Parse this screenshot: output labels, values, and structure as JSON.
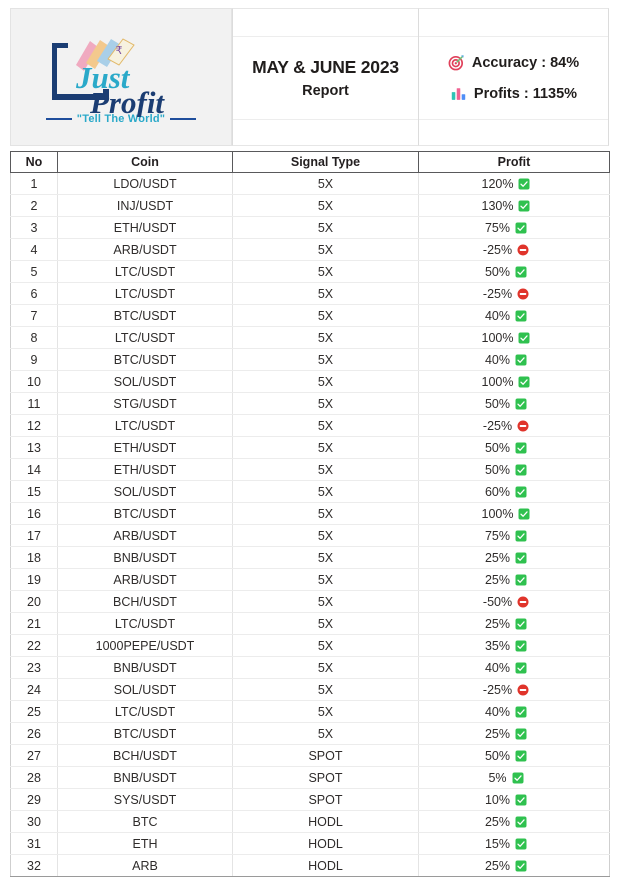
{
  "brand": {
    "name_line1": "Just",
    "name_line2": "Profit",
    "tagline": "\"Tell The World\"",
    "currency_symbol": "₹",
    "colors": {
      "navy": "#1b3d73",
      "cyan": "#2aa9c9",
      "tagline": "#2aa9c9"
    }
  },
  "header": {
    "title": "MAY & JUNE 2023",
    "subtitle": "Report",
    "stats": [
      {
        "icon": "target-icon",
        "label": "Accuracy",
        "value": "84%",
        "text": "Accuracy : 84%"
      },
      {
        "icon": "bar-chart-icon",
        "label": "Profits",
        "value": "1135%",
        "text": "Profits : 1135%"
      }
    ]
  },
  "table": {
    "columns": [
      "No",
      "Coin",
      "Signal Type",
      "Profit"
    ],
    "status_colors": {
      "positive": "#2fc14f",
      "negative": "#e0342b"
    },
    "rows": [
      {
        "no": "1",
        "coin": "LDO/USDT",
        "signal": "5X",
        "profit": "120%",
        "status": "positive"
      },
      {
        "no": "2",
        "coin": "INJ/USDT",
        "signal": "5X",
        "profit": "130%",
        "status": "positive"
      },
      {
        "no": "3",
        "coin": "ETH/USDT",
        "signal": "5X",
        "profit": "75%",
        "status": "positive"
      },
      {
        "no": "4",
        "coin": "ARB/USDT",
        "signal": "5X",
        "profit": "-25%",
        "status": "negative"
      },
      {
        "no": "5",
        "coin": "LTC/USDT",
        "signal": "5X",
        "profit": "50%",
        "status": "positive"
      },
      {
        "no": "6",
        "coin": "LTC/USDT",
        "signal": "5X",
        "profit": "-25%",
        "status": "negative"
      },
      {
        "no": "7",
        "coin": "BTC/USDT",
        "signal": "5X",
        "profit": "40%",
        "status": "positive"
      },
      {
        "no": "8",
        "coin": "LTC/USDT",
        "signal": "5X",
        "profit": "100%",
        "status": "positive"
      },
      {
        "no": "9",
        "coin": "BTC/USDT",
        "signal": "5X",
        "profit": "40%",
        "status": "positive"
      },
      {
        "no": "10",
        "coin": "SOL/USDT",
        "signal": "5X",
        "profit": "100%",
        "status": "positive"
      },
      {
        "no": "11",
        "coin": "STG/USDT",
        "signal": "5X",
        "profit": "50%",
        "status": "positive"
      },
      {
        "no": "12",
        "coin": "LTC/USDT",
        "signal": "5X",
        "profit": "-25%",
        "status": "negative"
      },
      {
        "no": "13",
        "coin": "ETH/USDT",
        "signal": "5X",
        "profit": "50%",
        "status": "positive"
      },
      {
        "no": "14",
        "coin": "ETH/USDT",
        "signal": "5X",
        "profit": "50%",
        "status": "positive"
      },
      {
        "no": "15",
        "coin": "SOL/USDT",
        "signal": "5X",
        "profit": "60%",
        "status": "positive"
      },
      {
        "no": "16",
        "coin": "BTC/USDT",
        "signal": "5X",
        "profit": "100%",
        "status": "positive"
      },
      {
        "no": "17",
        "coin": "ARB/USDT",
        "signal": "5X",
        "profit": "75%",
        "status": "positive"
      },
      {
        "no": "18",
        "coin": "BNB/USDT",
        "signal": "5X",
        "profit": "25%",
        "status": "positive"
      },
      {
        "no": "19",
        "coin": "ARB/USDT",
        "signal": "5X",
        "profit": "25%",
        "status": "positive"
      },
      {
        "no": "20",
        "coin": "BCH/USDT",
        "signal": "5X",
        "profit": "-50%",
        "status": "negative"
      },
      {
        "no": "21",
        "coin": "LTC/USDT",
        "signal": "5X",
        "profit": "25%",
        "status": "positive"
      },
      {
        "no": "22",
        "coin": "1000PEPE/USDT",
        "signal": "5X",
        "profit": "35%",
        "status": "positive"
      },
      {
        "no": "23",
        "coin": "BNB/USDT",
        "signal": "5X",
        "profit": "40%",
        "status": "positive"
      },
      {
        "no": "24",
        "coin": "SOL/USDT",
        "signal": "5X",
        "profit": "-25%",
        "status": "negative"
      },
      {
        "no": "25",
        "coin": "LTC/USDT",
        "signal": "5X",
        "profit": "40%",
        "status": "positive"
      },
      {
        "no": "26",
        "coin": "BTC/USDT",
        "signal": "5X",
        "profit": "25%",
        "status": "positive"
      },
      {
        "no": "27",
        "coin": "BCH/USDT",
        "signal": "SPOT",
        "profit": "50%",
        "status": "positive"
      },
      {
        "no": "28",
        "coin": "BNB/USDT",
        "signal": "SPOT",
        "profit": "5%",
        "status": "positive"
      },
      {
        "no": "29",
        "coin": "SYS/USDT",
        "signal": "SPOT",
        "profit": "10%",
        "status": "positive"
      },
      {
        "no": "30",
        "coin": "BTC",
        "signal": "HODL",
        "profit": "25%",
        "status": "positive"
      },
      {
        "no": "31",
        "coin": "ETH",
        "signal": "HODL",
        "profit": "15%",
        "status": "positive"
      },
      {
        "no": "32",
        "coin": "ARB",
        "signal": "HODL",
        "profit": "25%",
        "status": "positive"
      }
    ]
  }
}
